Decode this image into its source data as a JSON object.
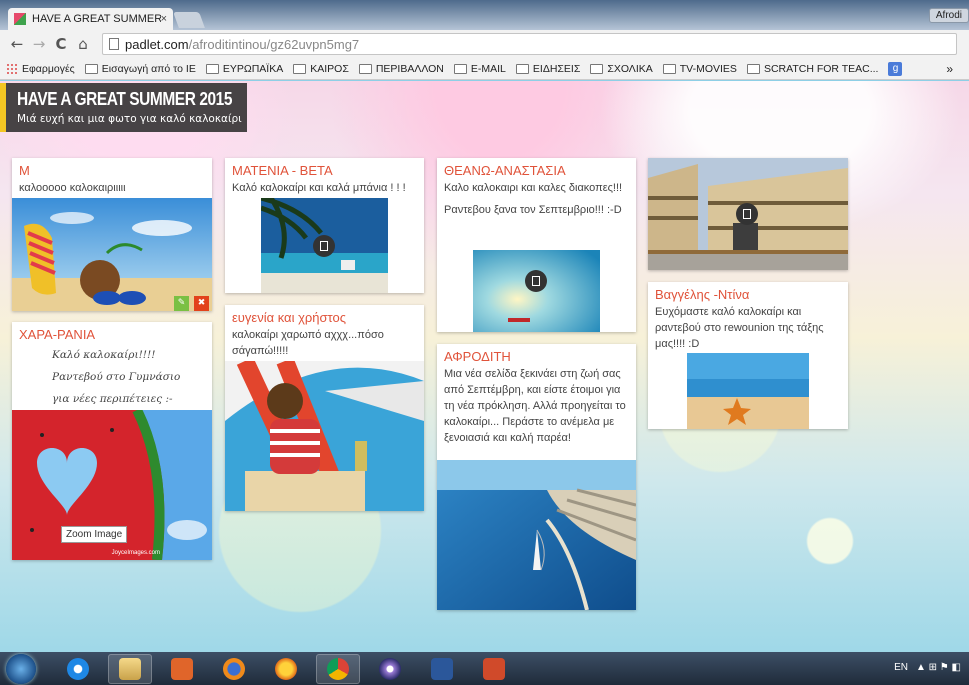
{
  "browser": {
    "tab_title": "HAVE A GREAT SUMMER",
    "tab_close": "×",
    "window_user": "Afrodi",
    "url_host": "padlet.com",
    "url_path": "/afroditintinou/gz62uvpn5mg7",
    "nav": {
      "back": "←",
      "forward": "→",
      "reload": "C",
      "home": "⌂"
    },
    "bookmarks": [
      {
        "label": "Εφαρμογές",
        "icon": "apps-icon"
      },
      {
        "label": "Εισαγωγή από το IE",
        "icon": "folder-icon"
      },
      {
        "label": "ΕΥΡΩΠΑΪΚΑ",
        "icon": "folder-icon"
      },
      {
        "label": "ΚΑΙΡΟΣ",
        "icon": "folder-icon"
      },
      {
        "label": "ΠΕΡΙΒΑΛΛΟΝ",
        "icon": "folder-icon"
      },
      {
        "label": "E-MAIL",
        "icon": "folder-icon"
      },
      {
        "label": "ΕΙΔΗΣΕΙΣ",
        "icon": "folder-icon"
      },
      {
        "label": "ΣΧΟΛΙΚΑ",
        "icon": "folder-icon"
      },
      {
        "label": "TV-MOVIES",
        "icon": "folder-icon"
      },
      {
        "label": "SCRATCH FOR TEAC...",
        "icon": "folder-icon"
      }
    ],
    "google_icon": "g",
    "bookmarks_more": "»"
  },
  "board": {
    "title": "HAVE A GREAT SUMMER 2015",
    "subtitle": "Μιά ευχή και μια φωτο για καλό καλοκαίρι"
  },
  "posts": {
    "m": {
      "title": "Μ",
      "text": "καλοοοοο καλοκαιριιιιι"
    },
    "xara": {
      "title": "ΧΑΡΑ-ΡΑΝΙΑ",
      "lines": [
        "Καλό καλοκαίρι!!!!",
        "Ραντεβού στο Γυμνάσιο",
        "για νέες περιπέτειες :-"
      ],
      "zoom_label": "Zoom Image",
      "credit": "JoyceImages.com"
    },
    "mateniabeta": {
      "title": "ΜΑΤΕΝΙΑ - ΒΕΤΑ",
      "text": "Καλό καλοκαίρι και καλά μπάνια ! ! !"
    },
    "eugenia": {
      "title": "ευγενία και χρήστος",
      "text": "καλοκαίρι χαρωπό αχχχ...πόσο σάγαπώ!!!!!"
    },
    "theano": {
      "title": "ΘΕΑΝΩ-ΑΝΑΣΤΑΣΙΑ",
      "text1": "Καλο καλοκαιρι και καλες διακοπες!!!",
      "text2": "Ραντεβου ξανα τον Σεπτεμβριο!!! :-D"
    },
    "afroditi": {
      "title": "ΑΦΡΟΔΙΤΗ",
      "text": "Μια νέα σελίδα ξεκινάει στη ζωή σας από Σεπτέμβρη, και είστε έτοιμοι για τη νέα πρόκληση. Αλλά προηγείται το καλοκαίρι... Περάστε το ανέμελα με ξενοιασιά και καλή παρέα!"
    },
    "vaggelis": {
      "title": "Βαγγέλης -Ντίνα",
      "text": "Ευχόμαστε καλό καλοκαίρι και ραντεβού στο rewounion της τάξης μας!!!! :D"
    }
  },
  "taskbar": {
    "tray_lang": "EN",
    "tray_icons": "▲ ⊞ ⚑ ◧"
  }
}
